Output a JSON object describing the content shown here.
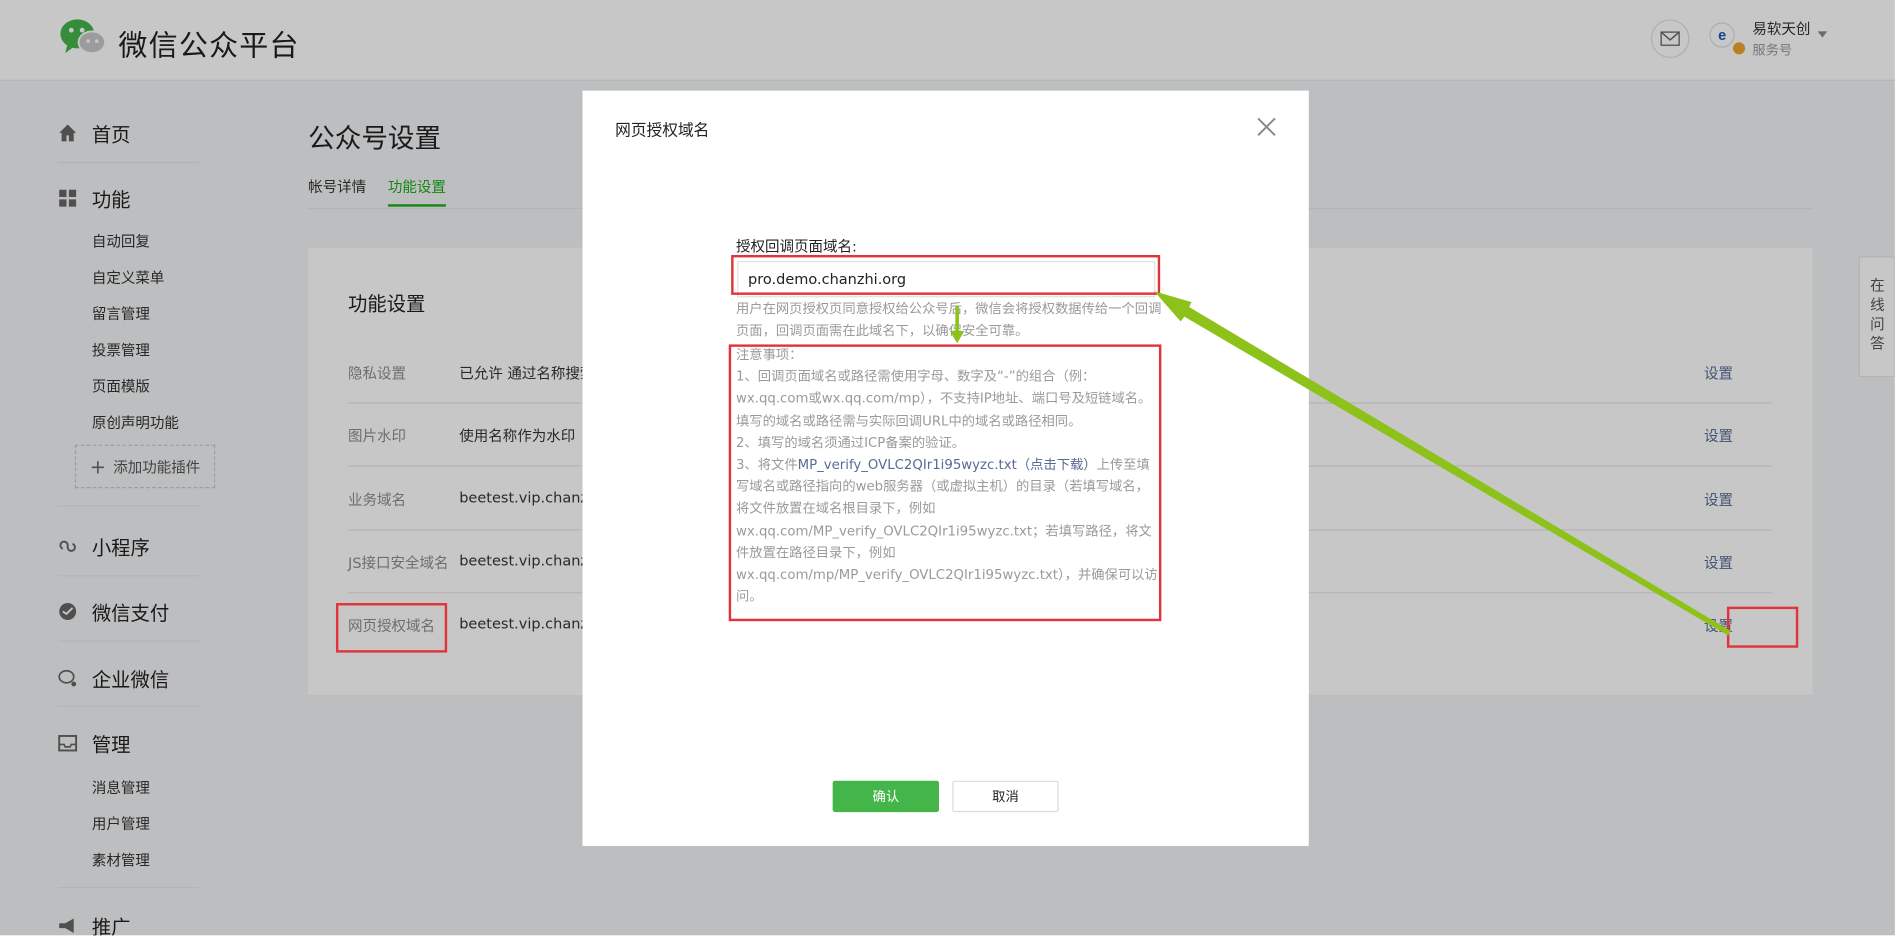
{
  "header": {
    "app_title": "微信公众平台",
    "account_name": "易软天创",
    "account_type": "服务号"
  },
  "sidebar": {
    "home": "首页",
    "function": "功能",
    "function_items": [
      "自动回复",
      "自定义菜单",
      "留言管理",
      "投票管理",
      "页面模版",
      "原创声明功能"
    ],
    "add_plugin": "添加功能插件",
    "mini_program": "小程序",
    "wechat_pay": "微信支付",
    "enterprise_wechat": "企业微信",
    "manage": "管理",
    "manage_items": [
      "消息管理",
      "用户管理",
      "素材管理"
    ],
    "promote": "推广"
  },
  "main": {
    "title": "公众号设置",
    "tabs": [
      "帐号详情",
      "功能设置"
    ],
    "card_title": "功能设置",
    "rows": [
      {
        "label": "隐私设置",
        "value": "已允许 通过名称搜索",
        "action": "设置"
      },
      {
        "label": "图片水印",
        "value": "使用名称作为水印",
        "action": "设置"
      },
      {
        "label": "业务域名",
        "value": "beetest.vip.chanzh",
        "action": "设置"
      },
      {
        "label": "JS接口安全域名",
        "value": "beetest.vip.chanzh",
        "action": "设置"
      },
      {
        "label": "网页授权域名",
        "value": "beetest.vip.chanzh",
        "action": "设置"
      }
    ]
  },
  "help_widget": "在线问答",
  "modal": {
    "title": "网页授权域名",
    "field_label": "授权回调页面域名:",
    "input_value": "pro.demo.chanzhi.org",
    "description": "用户在网页授权页同意授权给公众号后，微信会将授权数据传给一个回调页面，回调页面需在此域名下，以确保安全可靠。",
    "notes_title": "注意事项：",
    "note1": "1、回调页面域名或路径需使用字母、数字及“-”的组合（例：wx.qq.com或wx.qq.com/mp），不支持IP地址、端口号及短链域名。填写的域名或路径需与实际回调URL中的域名或路径相同。",
    "note2": "2、填写的域名须通过ICP备案的验证。",
    "note3_prefix": "3、将文件",
    "note3_file": "MP_verify_OVLC2QIr1i95wyzc.txt",
    "note3_download": "（点击下载）",
    "note3_suffix": "上传至填写域名或路径指向的web服务器（或虚拟主机）的目录（若填写域名，将文件放置在域名根目录下，例如wx.qq.com/MP_verify_OVLC2QIr1i95wyzc.txt；若填写路径，将文件放置在路径目录下，例如wx.qq.com/mp/MP_verify_OVLC2QIr1i95wyzc.txt），并确保可以访问。",
    "confirm": "确认",
    "cancel": "取消"
  },
  "colors": {
    "brand_green": "#44b549",
    "link_blue": "#576b95",
    "highlight_red": "#e0343a",
    "arrow_green": "#8cc21a"
  }
}
